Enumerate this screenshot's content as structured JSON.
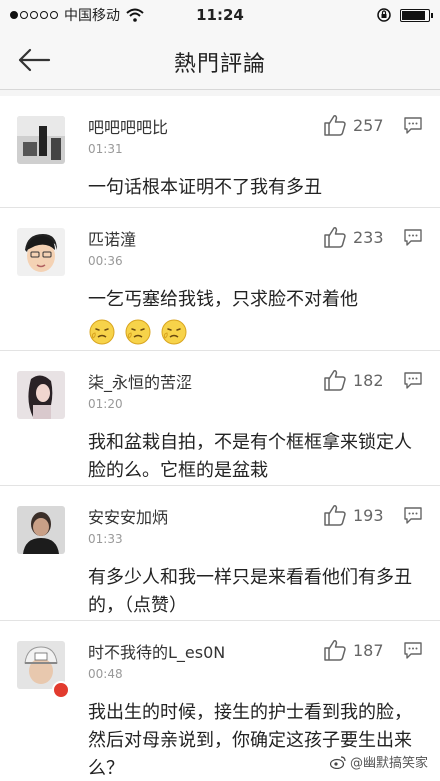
{
  "status_bar": {
    "carrier": "中国移动",
    "time": "11:24"
  },
  "nav": {
    "title": "熱門評論"
  },
  "comments": [
    {
      "username": "吧吧吧吧比",
      "time": "01:31",
      "likes": "257",
      "text": "一句话根本证明不了我有多丑"
    },
    {
      "username": "匹诺潼",
      "time": "00:36",
      "likes": "233",
      "text": "一乞丐塞给我钱，只求脸不对着他"
    },
    {
      "username": "柒_永恒的苦涩",
      "time": "01:20",
      "likes": "182",
      "text": "我和盆栽自拍，不是有个框框拿来锁定人脸的么。它框的是盆栽"
    },
    {
      "username": "安安安加炳",
      "time": "01:33",
      "likes": "193",
      "text": "有多少人和我一样只是来看看他们有多丑的，（点赞）"
    },
    {
      "username": "时不我待的L_es0N",
      "time": "00:48",
      "likes": "187",
      "text": "我出生的时候，接生的护士看到我的脸，然后对母亲说到，你确定这孩子要生出来么？"
    }
  ],
  "watermark": "@幽默搞笑家",
  "icons": {
    "back": "back-arrow-icon",
    "like": "thumbs-up-icon",
    "reply": "reply-bubble-icon",
    "emoji": "sweating-face-emoji"
  }
}
